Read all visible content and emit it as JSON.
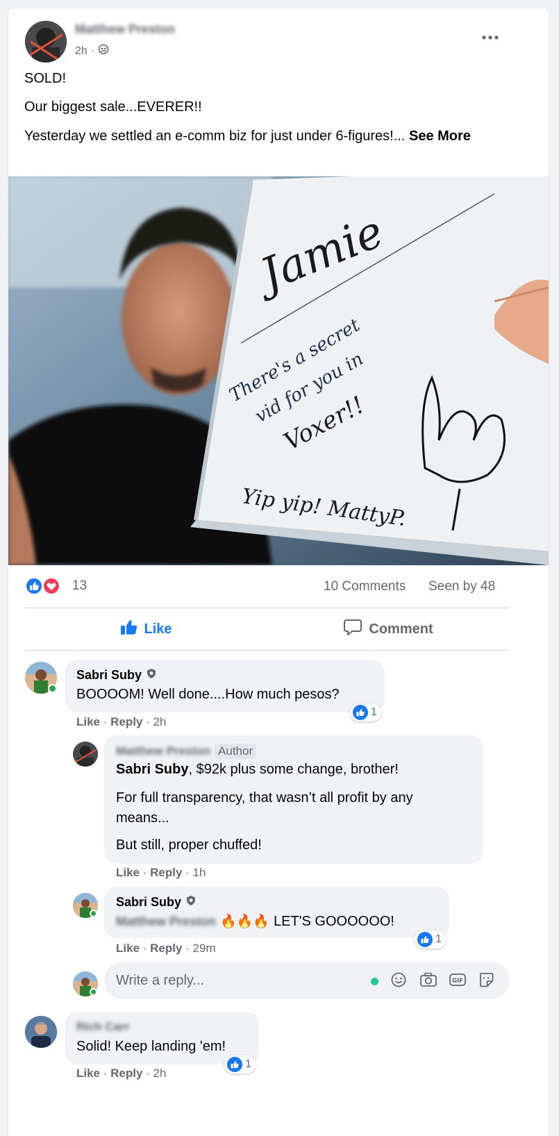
{
  "post": {
    "author_name": "Matthew Preston",
    "time": "2h",
    "separator": "·",
    "line1": "SOLD!",
    "line2": "Our biggest sale...EVERER!!",
    "line3": "Yesterday we settled an e-comm biz for just under 6-figures!...",
    "see_more": "See More",
    "photo": {
      "board_name": "Jamie",
      "board_line1": "There's a secret",
      "board_line2": "vid for you in",
      "board_line3": "Voxer!!",
      "board_sign": "Yip yip! MattyP."
    }
  },
  "stats": {
    "reaction_count": "13",
    "comments": "10 Comments",
    "seen_by": "Seen by 48"
  },
  "actions": {
    "like": "Like",
    "comment": "Comment"
  },
  "comments": [
    {
      "author": "Sabri Suby",
      "text": "BOOOOM! Well done....How much pesos?",
      "like": "Like",
      "reply": "Reply",
      "time": "2h",
      "reactions": "1"
    },
    {
      "author": "Matthew Preston",
      "badge": "Author",
      "mention": "Sabri Suby",
      "text1": ", $92k plus some change, brother!",
      "text2a": "For full transparency, that wasn’t all profit by any",
      "text2b": "means...",
      "text3": "But still, proper chuffed!",
      "like": "Like",
      "reply": "Reply",
      "time": "1h"
    },
    {
      "author": "Sabri Suby",
      "mention": "Matthew Preston",
      "emoji": "🔥🔥🔥",
      "text": "LET'S GOOOOOO!",
      "like": "Like",
      "reply": "Reply",
      "time": "29m",
      "reactions": "1"
    },
    {
      "author": "Rich Carr",
      "text": "Solid! Keep landing 'em!",
      "like": "Like",
      "reply": "Reply",
      "time": "2h",
      "reactions": "1"
    }
  ],
  "reply_box": {
    "placeholder": "Write a reply..."
  },
  "icons": [
    "more-icon",
    "audience-icon",
    "like-reaction-icon",
    "love-reaction-icon",
    "thumbs-up-icon",
    "comment-icon",
    "verified-badge-icon",
    "emoji-icon",
    "camera-icon",
    "gif-icon",
    "sticker-icon"
  ],
  "colors": {
    "accent": "#1877f2",
    "love": "#f33e58",
    "online": "#31a24c",
    "bubble": "#f0f2f5",
    "muted": "#65676b"
  }
}
